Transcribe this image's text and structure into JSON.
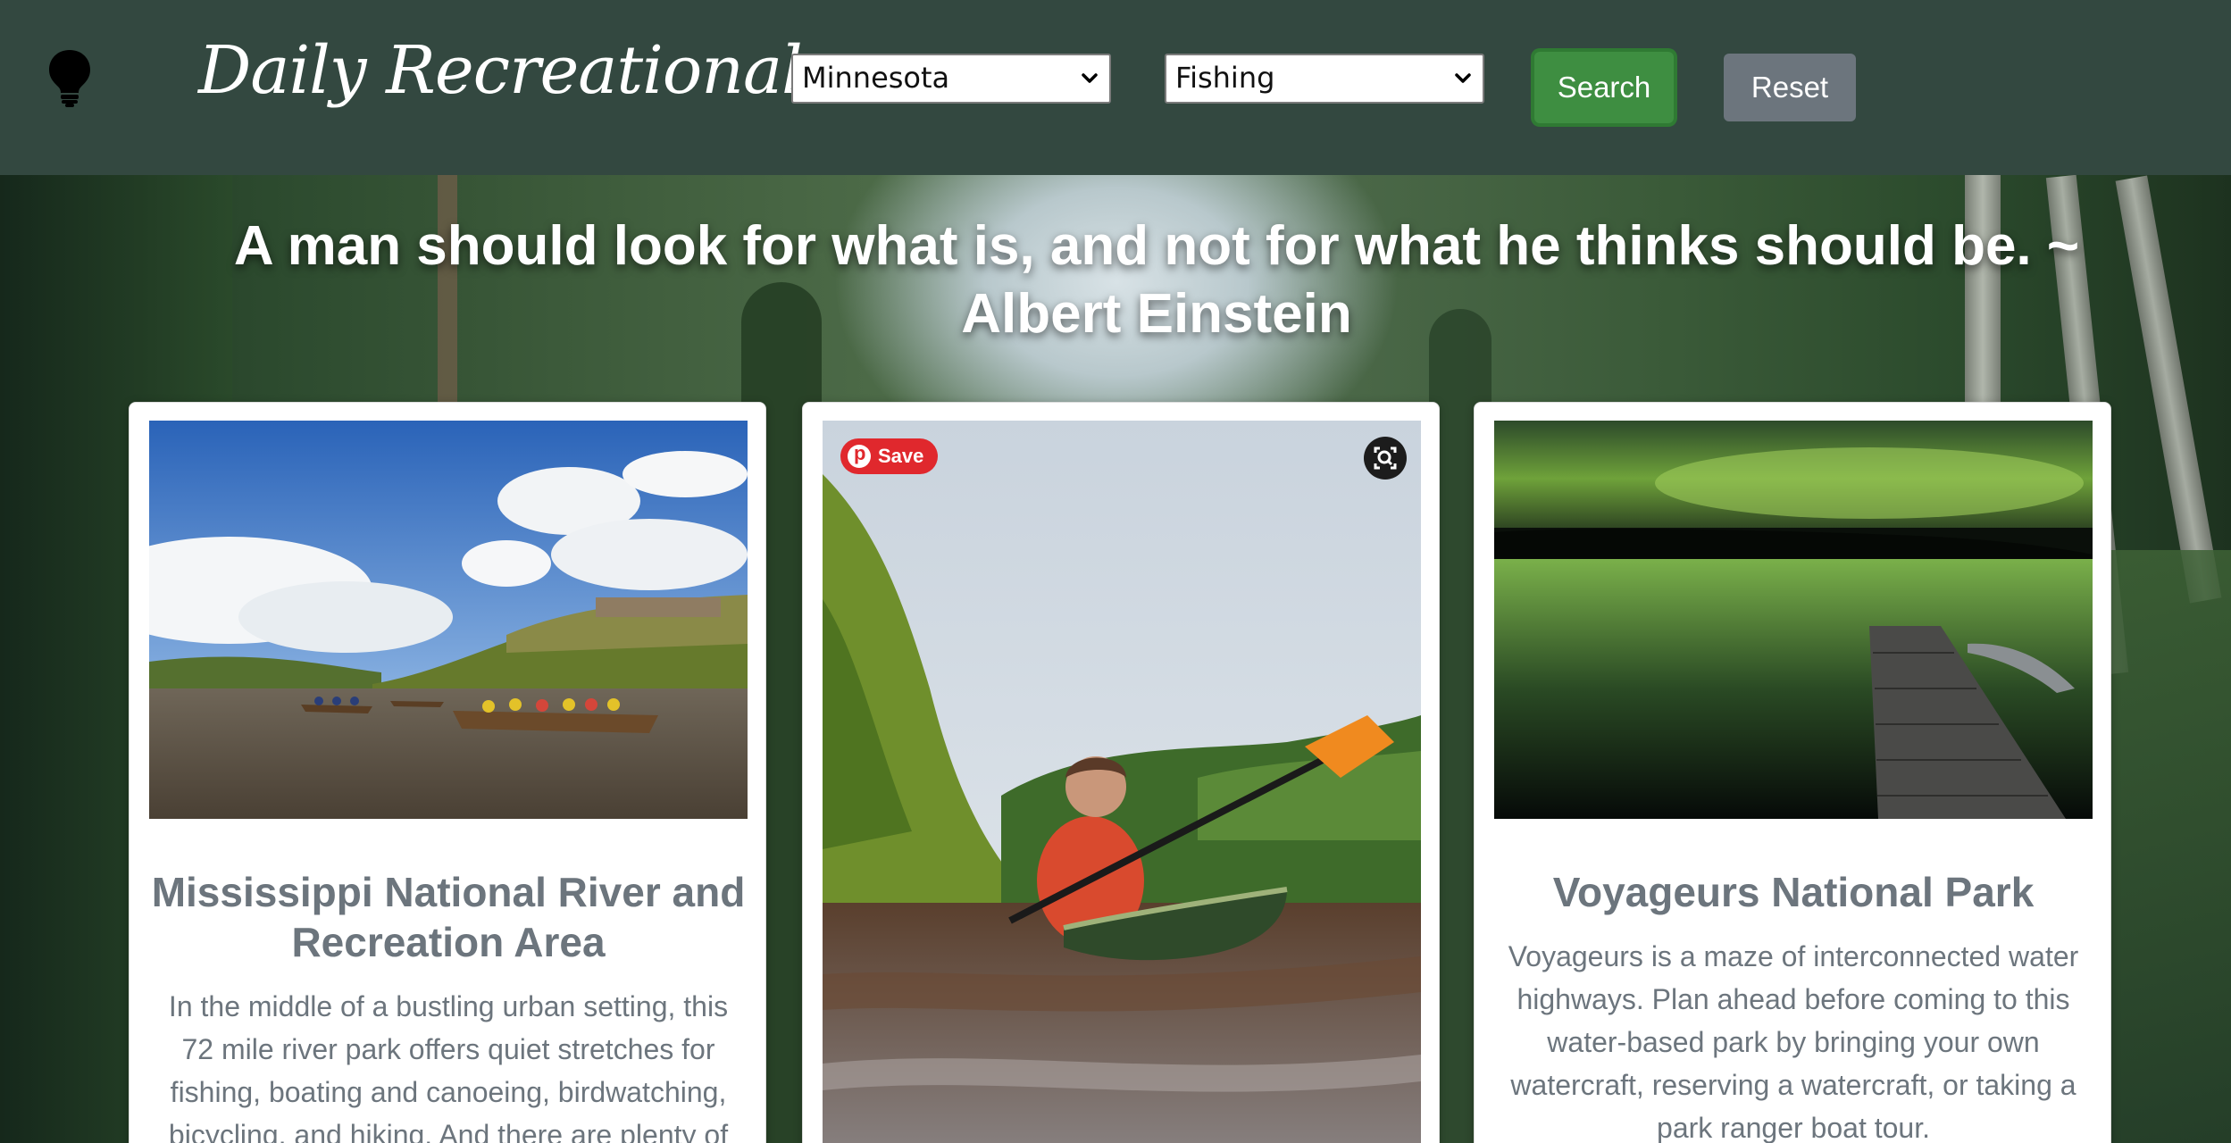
{
  "header": {
    "brand": "Daily Recreational",
    "state_select": {
      "selected": "Minnesota"
    },
    "activity_select": {
      "selected": "Fishing"
    },
    "search_label": "Search",
    "reset_label": "Reset",
    "icons": {
      "logo": "lightbulb-icon",
      "dropdown": "chevron-down-icon"
    }
  },
  "quote": {
    "text": "A man should look for what is, and not for what he thinks should be. ~ Albert Einstein"
  },
  "cards": [
    {
      "title": "Mississippi National River and Recreation Area",
      "description": "In the middle of a bustling urban setting, this 72 mile river park offers quiet stretches for fishing, boating and canoeing, birdwatching, bicycling, and hiking. And there are plenty of",
      "image_icon": "river-canoe-photo"
    },
    {
      "title": "",
      "description": "",
      "image_icon": "kayaker-photo",
      "save_label": "Save",
      "overlay_icons": [
        "pinterest-icon",
        "visual-search-icon"
      ]
    },
    {
      "title": "Voyageurs National Park",
      "description": "Voyageurs is a maze of interconnected water highways. Plan ahead before coming to this water-based park by bringing your own watercraft, reserving a watercraft, or taking a park ranger boat tour.",
      "image_icon": "aurora-dock-photo"
    }
  ],
  "colors": {
    "header_bg": "#334840",
    "search_button": "#3e8e41",
    "reset_button": "#6c757d",
    "card_text": "#6c757d",
    "pinterest_red": "#e0282d"
  }
}
